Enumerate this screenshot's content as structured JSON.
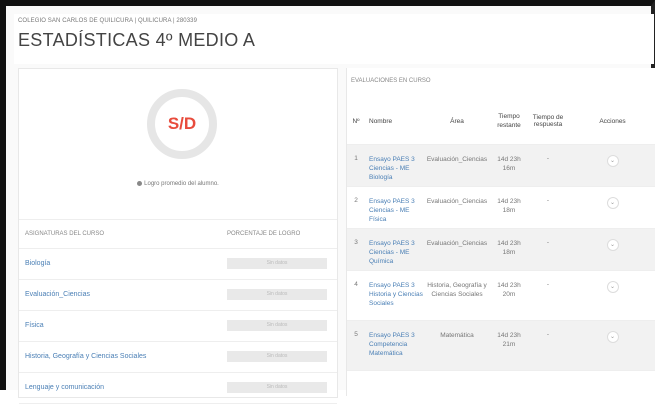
{
  "header": {
    "breadcrumb": "COLEGIO SAN CARLOS DE QUILICURA | QUILICURA | 280339",
    "title": "ESTADÍSTICAS 4º MEDIO A"
  },
  "summary": {
    "value": "S/D",
    "hint": "Logro promedio del alumno."
  },
  "subjects": {
    "col_subject": "ASIGNATURAS DEL CURSO",
    "col_percent": "PORCENTAJE DE LOGRO",
    "items": [
      {
        "name": "Biología",
        "value": "Sin datos"
      },
      {
        "name": "Evaluación_Ciencias",
        "value": "Sin datos"
      },
      {
        "name": "Física",
        "value": "Sin datos"
      },
      {
        "name": "Historia, Geografía y Ciencias Sociales",
        "value": "Sin datos"
      },
      {
        "name": "Lenguaje y comunicación",
        "value": "Sin datos"
      }
    ]
  },
  "evaluations": {
    "title": "EVALUACIONES EN CURSO",
    "columns": [
      "Nº",
      "Nombre",
      "Área",
      "Tiempo restante",
      "Tiempo de respuesta",
      "Acciones"
    ],
    "rows": [
      {
        "n": "1",
        "name": "Ensayo PAES 3 Ciencias - ME Biología",
        "area": "Evaluación_Ciencias",
        "time": "14d 23h 16m",
        "resp": "-"
      },
      {
        "n": "2",
        "name": "Ensayo PAES 3 Ciencias - ME Física",
        "area": "Evaluación_Ciencias",
        "time": "14d 23h 18m",
        "resp": "-"
      },
      {
        "n": "3",
        "name": "Ensayo PAES 3 Ciencias - ME Química",
        "area": "Evaluación_Ciencias",
        "time": "14d 23h 18m",
        "resp": "-"
      },
      {
        "n": "4",
        "name": "Ensayo PAES 3 Historia y Ciencias Sociales",
        "area": "Historia, Geografía y Ciencias Sociales",
        "time": "14d 23h 20m",
        "resp": "-"
      },
      {
        "n": "5",
        "name": "Ensayo PAES 3 Competencia Matemática",
        "area": "Matemática",
        "time": "14d 23h 21m",
        "resp": "-"
      }
    ]
  }
}
